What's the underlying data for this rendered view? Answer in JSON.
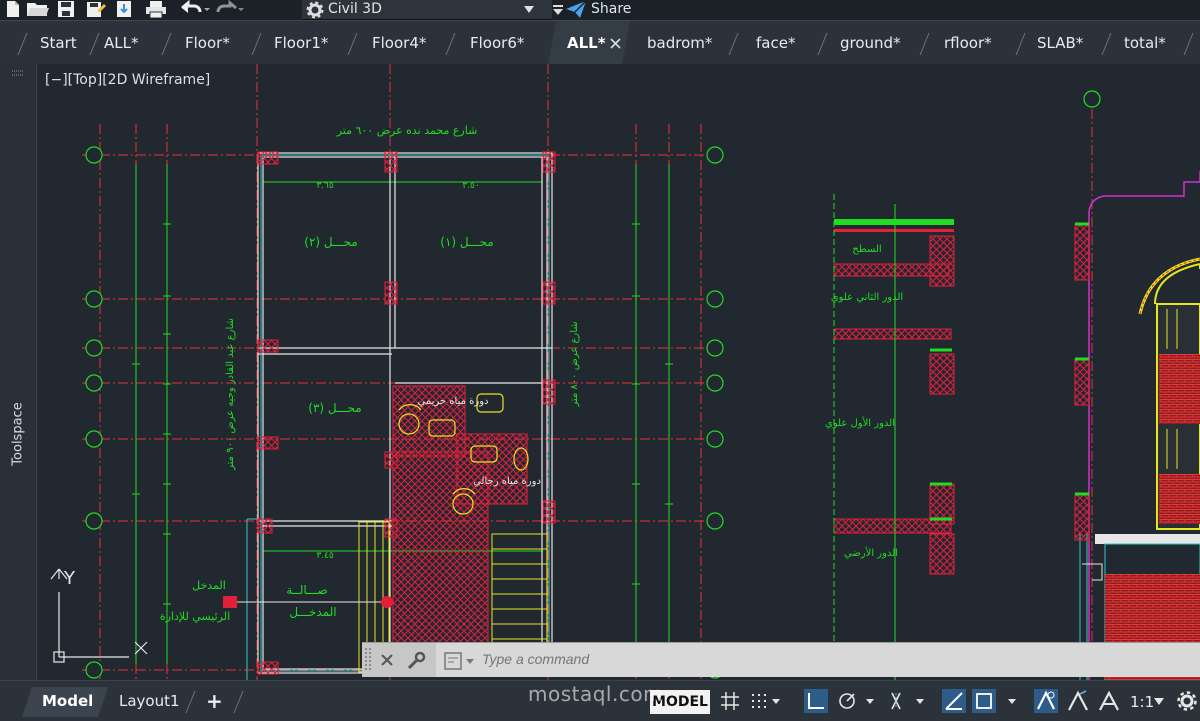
{
  "quick_access": {
    "workspace_label": "Civil 3D",
    "share_label": "Share",
    "icons": [
      "new-icon",
      "open-icon",
      "save-icon",
      "save-as-icon",
      "publish-icon",
      "print-icon",
      "undo-icon",
      "redo-icon",
      "workspace-gear-icon",
      "share-icon"
    ]
  },
  "tabs": [
    {
      "label": "Start"
    },
    {
      "label": "ALL*"
    },
    {
      "label": "Floor*"
    },
    {
      "label": "Floor1*"
    },
    {
      "label": "Floor4*"
    },
    {
      "label": "Floor6*"
    },
    {
      "label": "ALL*",
      "active": true
    },
    {
      "label": "badrom*"
    },
    {
      "label": "face*"
    },
    {
      "label": "ground*"
    },
    {
      "label": "rfloor*"
    },
    {
      "label": "SLAB*"
    },
    {
      "label": "total*"
    }
  ],
  "toolspace": {
    "label": "Toolspace"
  },
  "viewport": {
    "controls": "[−][Top][2D Wireframe]"
  },
  "drawing": {
    "street_top": "شارع محمد نده عرض ٦٠٠ متر",
    "street_left": "شارع عبد القادر وجيه عرض ٩٠٠ متر",
    "street_right": "شارع عرض ٨٠٠ متر",
    "shop1": "محـــل (١)",
    "shop2": "محـــل (٢)",
    "shop3": "محـــل (٣)",
    "wc_men": "دورة مياه رجالي",
    "wc_women": "دورة مياه حريمي",
    "hall": "صـــالــة",
    "entrance_word": "المدخـــل",
    "main_entrance": "المدخل",
    "admin_entrance": "الرئيسي للإدارة",
    "roof": "السطح",
    "second_floor": "الدور الثاني علوي",
    "first_floor": "الدور الأول علوي",
    "ground_floor": "الدور الأرضي",
    "dim_a": "٣.٦٥",
    "dim_b": "٣.٥٠",
    "dim_c": "٣.٤٥",
    "axis_x": "X",
    "axis_y": "Y"
  },
  "command_line": {
    "placeholder": "Type a command"
  },
  "status_bar": {
    "tab_model": "Model",
    "tab_layout1": "Layout1",
    "add_layout": "+",
    "model_button": "MODEL",
    "scale": "1:1"
  },
  "watermark": "mostaql.com",
  "colors": {
    "background": "#212830",
    "grid_red": "#e8323a",
    "label_green": "#22dc22",
    "wall_white": "#e7e7e7",
    "column_red": "#e2203b",
    "magenta": "#d030d0",
    "yellow": "#e6e61e",
    "cyan": "#32c8c8"
  }
}
